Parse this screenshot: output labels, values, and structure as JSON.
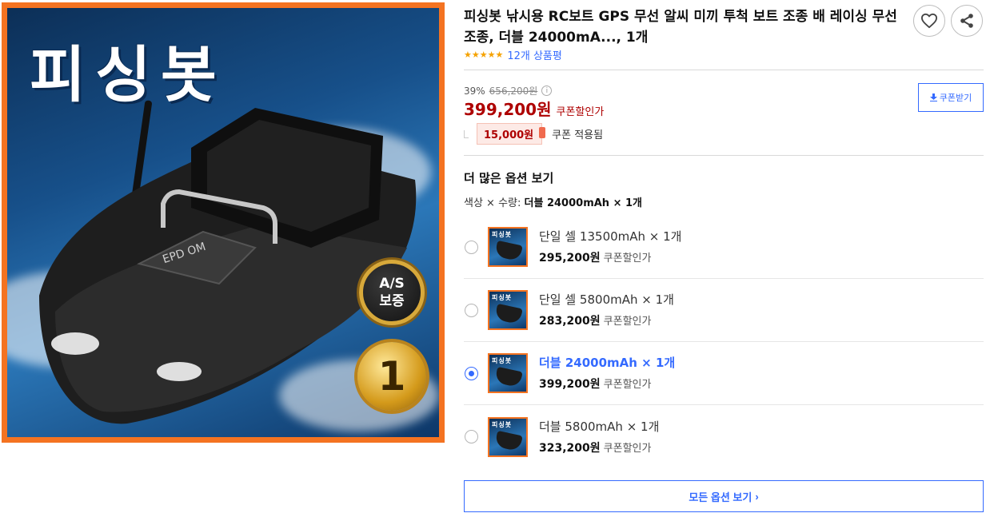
{
  "product": {
    "title": "피싱봇 낚시용 RC보트 GPS 무선 알씨 미끼 투척 보트 조종 배 레이싱 무선조종, 더블 24000mA..., 1개",
    "image_overlay_text": "피싱봇",
    "image_badge_as_line1": "A/S",
    "image_badge_as_line2": "보증",
    "image_badge_rank": "1",
    "image_boat_label": "EPD OM"
  },
  "rating": {
    "stars": "★★★★★",
    "review_count": "12개 상품평"
  },
  "actions": {
    "wishlist_icon": "heart-icon",
    "share_icon": "share-icon"
  },
  "price": {
    "discount_rate": "39%",
    "original_price": "656,200원",
    "sale_price": "399,200원",
    "sale_note": "쿠폰할인가",
    "coupon_button_label": "쿠폰받기",
    "coupon_amount": "15,000원",
    "coupon_applied_label": "쿠폰 적용됨"
  },
  "options": {
    "section_title": "더 많은 옵션 보기",
    "summary_prefix": "색상 × 수량: ",
    "summary_value": "더블 24000mAh × 1개",
    "thumb_text": "피싱봇",
    "items": [
      {
        "name": "단일 셀 13500mAh × 1개",
        "price": "295,200원",
        "note": "쿠폰할인가",
        "selected": false
      },
      {
        "name": "단일 셀 5800mAh × 1개",
        "price": "283,200원",
        "note": "쿠폰할인가",
        "selected": false
      },
      {
        "name": "더블 24000mAh × 1개",
        "price": "399,200원",
        "note": "쿠폰할인가",
        "selected": true
      },
      {
        "name": "더블 5800mAh × 1개",
        "price": "323,200원",
        "note": "쿠폰할인가",
        "selected": false
      }
    ],
    "all_options_label": "모든 옵션 보기",
    "all_options_chevron": "›"
  },
  "colors": {
    "accent_blue": "#346aff",
    "price_red": "#ae0000",
    "image_border_orange": "#f47321",
    "star_yellow": "#f5a200"
  }
}
